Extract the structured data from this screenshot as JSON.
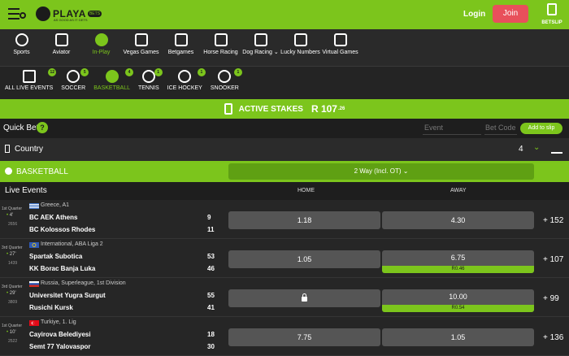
{
  "header": {
    "brand": "PLAYA",
    "brand_badge": "BETS",
    "tagline": "AS GOOD AS IT GETS",
    "login": "Login",
    "join": "Join",
    "betslip": "BETSLIP"
  },
  "nav": [
    {
      "label": "Sports",
      "icon": "football-icon"
    },
    {
      "label": "Aviator",
      "icon": "plane-icon"
    },
    {
      "label": "In-Play",
      "icon": "live-ball-icon",
      "active": true
    },
    {
      "label": "Vegas Games",
      "icon": "slot-machine-icon"
    },
    {
      "label": "Betgames",
      "icon": "betgames-icon"
    },
    {
      "label": "Horse Racing",
      "icon": "horse-icon"
    },
    {
      "label": "Dog Racing ⌄",
      "icon": "dog-icon"
    },
    {
      "label": "Lucky Numbers",
      "icon": "lottery-icon"
    },
    {
      "label": "Virtual Games",
      "icon": "virtual-icon"
    }
  ],
  "sports_filter": [
    {
      "label": "ALL LIVE EVENTS",
      "count": "12"
    },
    {
      "label": "SOCCER",
      "count": "5"
    },
    {
      "label": "BASKETBALL",
      "count": "4",
      "active": true
    },
    {
      "label": "TENNIS",
      "count": "1"
    },
    {
      "label": "ICE HOCKEY",
      "count": "1"
    },
    {
      "label": "SNOOKER",
      "count": "1"
    }
  ],
  "stakes": {
    "label": "ACTIVE STAKES",
    "amount": "R 107",
    "cents": ".26"
  },
  "quickbet": {
    "title": "Quick Bet",
    "help": "?",
    "event_placeholder": "Event",
    "betcode_placeholder": "Bet Code",
    "add_label": "Add to slip"
  },
  "country": {
    "label": "Country",
    "count": "4"
  },
  "sport_header": {
    "label": "BASKETBALL",
    "market": "2 Way (Incl. OT) ⌄"
  },
  "live": {
    "title": "Live Events",
    "home": "HOME",
    "away": "AWAY"
  },
  "events": [
    {
      "period": "1st Quarter",
      "clock": "4'",
      "id": "2656",
      "league": "Greece, A1",
      "team1": "BC AEK Athens",
      "team2": "BC Kolossos Rhodes",
      "score1": "9",
      "score2": "11",
      "home": "1.18",
      "away": "4.30",
      "more": "+ 152"
    },
    {
      "period": "3rd Quarter",
      "clock": "27'",
      "id": "1439",
      "league": "International, ABA Liga 2",
      "team1": "Spartak Subotica",
      "team2": "KK Borac Banja Luka",
      "score1": "53",
      "score2": "46",
      "home": "1.05",
      "away": "6.75",
      "away_delta": "R0.46",
      "more": "+ 107"
    },
    {
      "period": "3rd Quarter",
      "clock": "29'",
      "id": "3809",
      "league": "Russia, Superleague, 1st Division",
      "team1": "Universitet Yugra Surgut",
      "team2": "Rusichi Kursk",
      "score1": "55",
      "score2": "41",
      "home": "",
      "away": "10.00",
      "away_delta": "R0.54",
      "more": "+ 99"
    },
    {
      "period": "1st Quarter",
      "clock": "10'",
      "id": "2522",
      "league": "Turkiye, 1. Lig",
      "team1": "Cayirova Belediyesi",
      "team2": "Semt 77 Yalovaspor",
      "score1": "18",
      "score2": "30",
      "home": "7.75",
      "away": "1.05",
      "more": "+ 136"
    }
  ],
  "colors": {
    "accent": "#7cc51c",
    "join": "#e8505b"
  }
}
